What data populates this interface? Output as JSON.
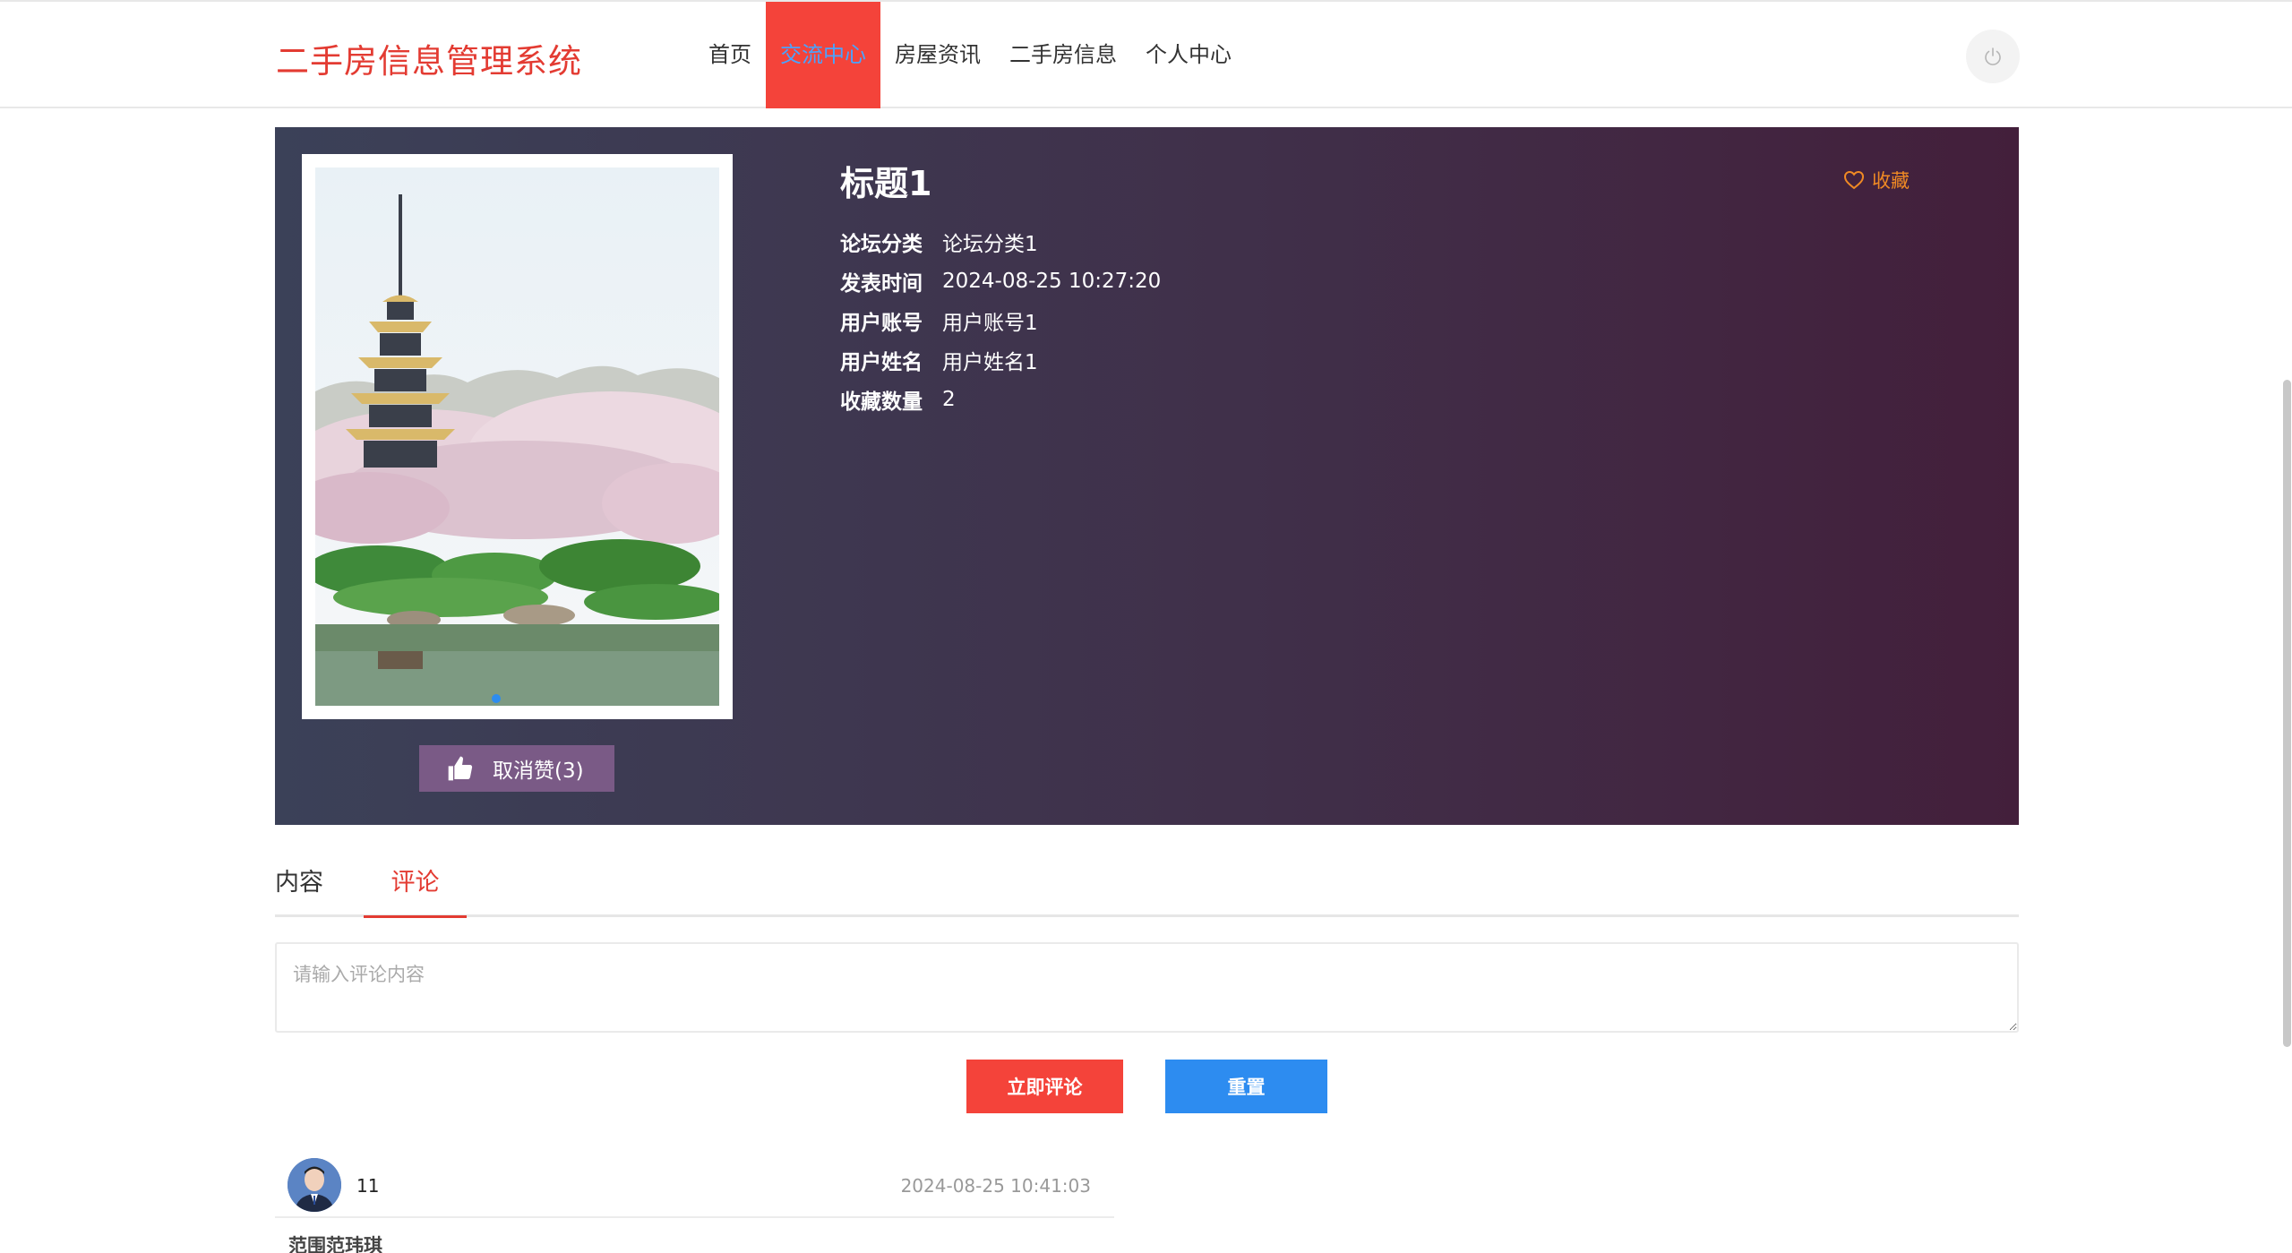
{
  "header": {
    "brand": "二手房信息管理系统",
    "nav": [
      {
        "label": "首页",
        "active": false
      },
      {
        "label": "交流中心",
        "active": true
      },
      {
        "label": "房屋资讯",
        "active": false
      },
      {
        "label": "二手房信息",
        "active": false
      },
      {
        "label": "个人中心",
        "active": false
      }
    ],
    "power_icon": "power-icon"
  },
  "post": {
    "title": "标题1",
    "favorite_label": "收藏",
    "like_label": "取消赞(3)",
    "fields": [
      {
        "label": "论坛分类",
        "value": "论坛分类1"
      },
      {
        "label": "发表时间",
        "value": "2024-08-25 10:27:20"
      },
      {
        "label": "用户账号",
        "value": "用户账号1"
      },
      {
        "label": "用户姓名",
        "value": "用户姓名1"
      },
      {
        "label": "收藏数量",
        "value": "2"
      }
    ]
  },
  "tabs": [
    {
      "label": "内容",
      "active": false
    },
    {
      "label": "评论",
      "active": true
    }
  ],
  "comment_form": {
    "placeholder": "请输入评论内容",
    "value": "",
    "submit_label": "立即评论",
    "reset_label": "重置"
  },
  "comments": [
    {
      "user": "11",
      "time": "2024-08-25 10:41:03",
      "text": "范围范玮琪"
    }
  ],
  "colors": {
    "brand_red": "#e33b32",
    "nav_active_bg": "#f4433a",
    "submit_bg": "#f4433a",
    "reset_bg": "#2d8cf0",
    "favorite": "#f08a24",
    "like_btn_bg": "#7a5a86"
  }
}
